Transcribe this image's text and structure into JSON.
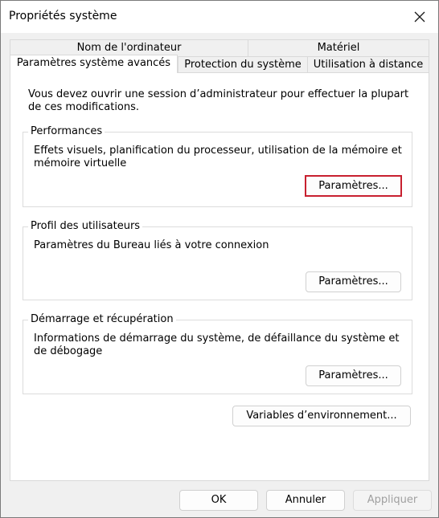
{
  "window": {
    "title": "Propriétés système",
    "close_icon": "close-icon"
  },
  "tabs": {
    "row_top": [
      {
        "label": "Nom de l'ordinateur"
      },
      {
        "label": "Matériel"
      }
    ],
    "row_bottom": [
      {
        "label": "Paramètres système avancés",
        "selected": true
      },
      {
        "label": "Protection du système"
      },
      {
        "label": "Utilisation à distance"
      }
    ]
  },
  "main": {
    "info_text": "Vous devez ouvrir une session d’administrateur pour effectuer la plupart de ces modifications.",
    "groups": [
      {
        "title": "Performances",
        "description": "Effets visuels, planification du processeur, utilisation de la mémoire et mémoire virtuelle",
        "button_label": "Paramètres..."
      },
      {
        "title": "Profil des utilisateurs",
        "description": "Paramètres du Bureau liés à votre connexion",
        "button_label": "Paramètres..."
      },
      {
        "title": "Démarrage et récupération",
        "description": "Informations de démarrage du système, de défaillance du système et de débogage",
        "button_label": "Paramètres..."
      }
    ],
    "env_button_label": "Variables d’environnement..."
  },
  "footer": {
    "ok_label": "OK",
    "cancel_label": "Annuler",
    "apply_label": "Appliquer"
  },
  "colors": {
    "highlight_border": "#c8202f",
    "dialog_background": "#f0f0f0",
    "panel_background": "#ffffff"
  }
}
